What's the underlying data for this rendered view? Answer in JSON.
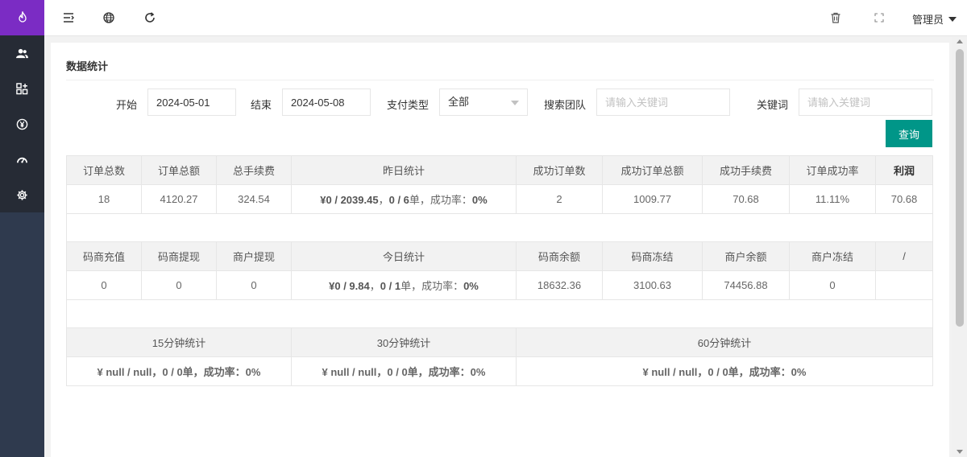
{
  "sidebar": {
    "logo_icon": "flame-icon",
    "items": [
      {
        "icon": "users-icon"
      },
      {
        "icon": "apps-icon"
      },
      {
        "icon": "yen-icon"
      },
      {
        "icon": "dashboard-icon"
      },
      {
        "icon": "gear-icon"
      }
    ],
    "colors": {
      "logo_bg": "#7b2cc4",
      "menu_bg": "#262b35",
      "sidebar_bg": "#2f3a4e"
    }
  },
  "topbar": {
    "icons": [
      "menu-toggle-icon",
      "globe-icon",
      "refresh-icon",
      "trash-icon",
      "fullscreen-icon"
    ],
    "user": "管理员"
  },
  "main": {
    "title": "数据统计",
    "filters": {
      "start_label": "开始",
      "start_value": "2024-05-01",
      "end_label": "结束",
      "end_value": "2024-05-08",
      "pay_type_label": "支付类型",
      "pay_type_value": "全部",
      "team_label": "搜索团队",
      "team_placeholder": "请输入关键词",
      "keyword_label": "关键词",
      "keyword_placeholder": "请输入关键词",
      "query_button": "查询"
    },
    "accent": "#009688",
    "table1": {
      "headers": [
        "订单总数",
        "订单总额",
        "总手续费",
        "昨日统计",
        "成功订单数",
        "成功订单总额",
        "成功手续费",
        "订单成功率",
        "利润"
      ],
      "values": [
        "18",
        "4120.27",
        "324.54",
        "",
        "2",
        "1009.77",
        "70.68",
        "11.11%",
        "70.68"
      ],
      "yesterday": {
        "prefix": "¥",
        "a": "0",
        "b": "2039.45",
        "c": "0",
        "d": "6",
        "unit": "单，成功率：",
        "rate": "0%"
      }
    },
    "table2": {
      "headers": [
        "码商充值",
        "码商提现",
        "商户提现",
        "今日统计",
        "码商余额",
        "码商冻结",
        "商户余额",
        "商户冻结",
        "/"
      ],
      "values": [
        "0",
        "0",
        "0",
        "",
        "18632.36",
        "3100.63",
        "74456.88",
        "0",
        ""
      ],
      "today": {
        "prefix": "¥",
        "a": "0",
        "b": "9.84",
        "c": "0",
        "d": "1",
        "unit": "单，成功率：",
        "rate": "0%"
      }
    },
    "table3": {
      "headers": [
        "15分钟统计",
        "30分钟统计",
        "60分钟统计"
      ],
      "values": [
        "¥ null / null，0 / 0单，成功率：0%",
        "¥ null / null，0 / 0单，成功率：0%",
        "¥ null / null，0 / 0单，成功率：0%"
      ]
    }
  }
}
